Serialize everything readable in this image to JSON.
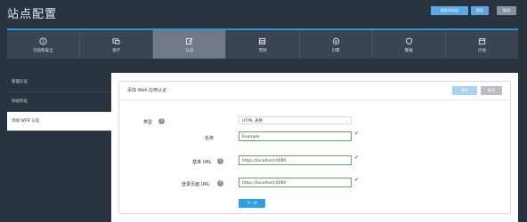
{
  "header": {
    "title": "站点配置",
    "buttons": [
      "保存并启动",
      "保存",
      "取消"
    ]
  },
  "tabs": [
    {
      "label": "信息和安全",
      "icon": "info-icon"
    },
    {
      "label": "资产",
      "icon": "assets-icon"
    },
    {
      "label": "认证",
      "icon": "auth-icon",
      "active": true
    },
    {
      "label": "范例",
      "icon": "template-icon"
    },
    {
      "label": "引擎",
      "icon": "engine-icon"
    },
    {
      "label": "警报",
      "icon": "alert-icon"
    },
    {
      "label": "计划",
      "icon": "calendar-icon"
    }
  ],
  "sidebar": {
    "items": [
      "管理认证",
      "添加凭证",
      "添加 WEB 认证"
    ],
    "active_index": 2
  },
  "form": {
    "title": "添加 Web 应用认证",
    "save": "保存",
    "cancel": "取消",
    "type_label": "类型",
    "type_value": "HTML 表格",
    "name_label": "名称",
    "name_value": "Example",
    "base_url_label": "基准 URL",
    "base_url_value": "https://localhost:0000",
    "login_url_label": "登录页面 URL",
    "login_url_value": "https://localhost:0000",
    "next": "下一步"
  },
  "colors": {
    "background": "#2a3441",
    "accent": "#2b95d3",
    "active_tab": "#6f7a86",
    "valid": "#3a9a3a"
  }
}
